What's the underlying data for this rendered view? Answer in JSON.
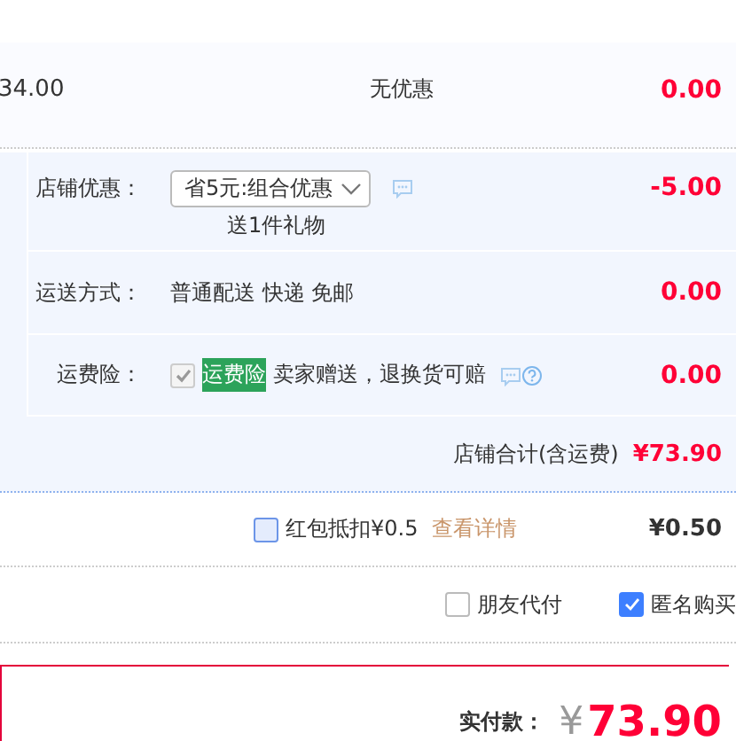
{
  "item_row": {
    "price": "34.00",
    "discount": "无优惠",
    "amount": "0.00"
  },
  "shop_options": [
    {
      "kind": "select",
      "label": "店铺优惠：",
      "value": "省5元:组合优惠",
      "note": "送1件礼物",
      "amount": "-5.00"
    },
    {
      "kind": "text",
      "label": "运送方式：",
      "value": "普通配送 快递 免邮",
      "amount": "0.00"
    },
    {
      "kind": "insurance",
      "label": "运费险：",
      "checked": true,
      "disabled": true,
      "tag": "运费险",
      "value": "卖家赠送，退换货可赔",
      "amount": "0.00"
    }
  ],
  "shop_total": {
    "label": "店铺合计(含运费)",
    "amount": "¥73.90"
  },
  "red_packet": {
    "checked": false,
    "label": "红包抵扣¥0.5",
    "link": "查看详情",
    "amount": "¥0.50"
  },
  "options": [
    {
      "label": "朋友代付",
      "checked": false
    },
    {
      "label": "匿名购买",
      "checked": true
    }
  ],
  "payment": {
    "label": "实付款：",
    "currency": "¥",
    "amount": "73.90"
  }
}
